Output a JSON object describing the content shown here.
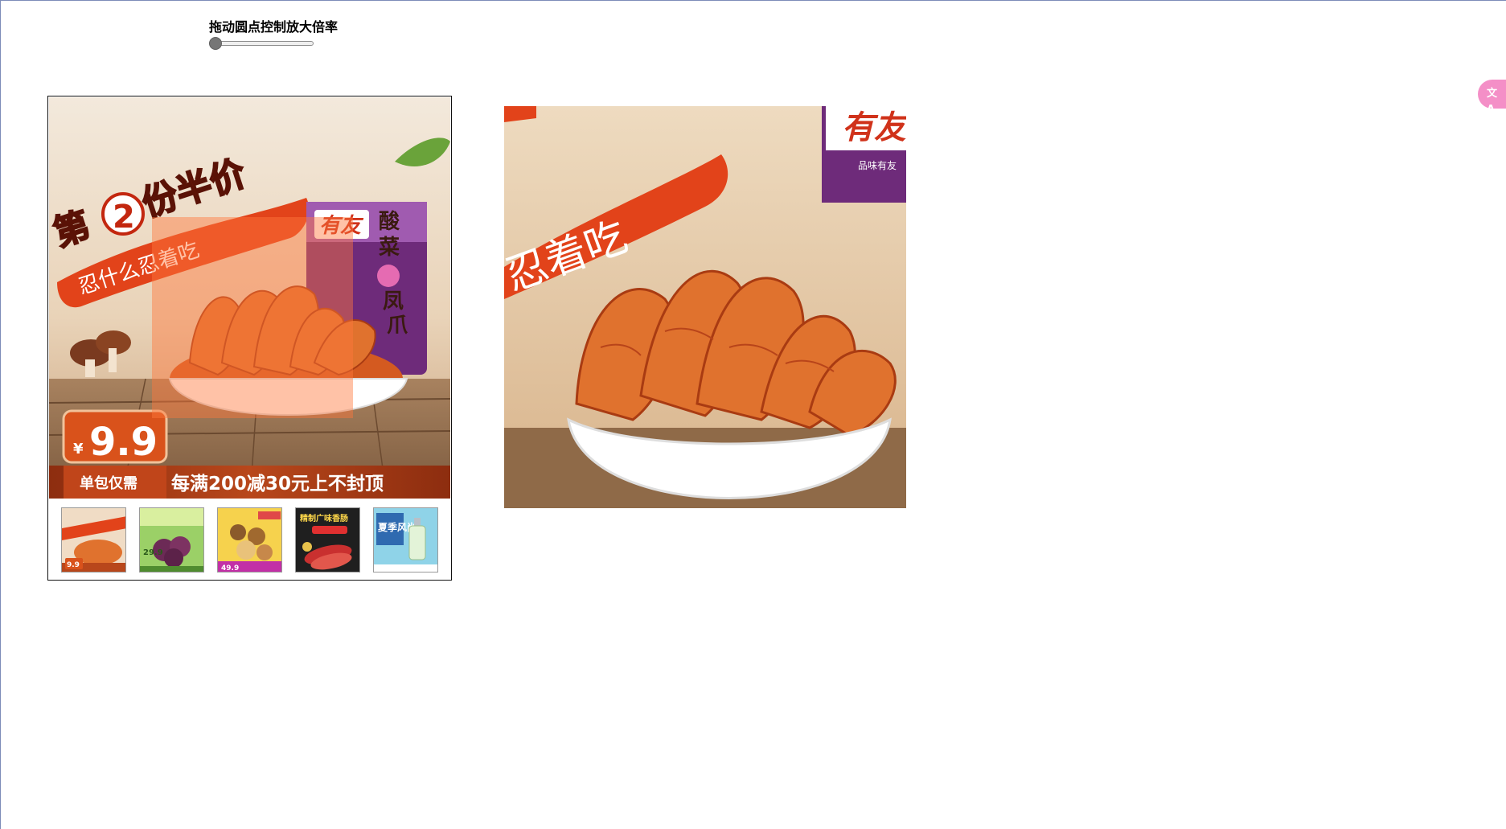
{
  "zoom_control": {
    "title": "拖动圆点控制放大倍率",
    "level": 0
  },
  "product": {
    "main": {
      "headline_prefix": "第",
      "headline_number": "2",
      "headline_suffix": "份半价",
      "slogan": "忍什么忍着吃",
      "brand": "有友",
      "bag_title_1": "酸",
      "bag_title_2": "菜",
      "bag_title_3": "凤",
      "bag_title_4": "爪",
      "price_currency": "¥",
      "price": "9.9",
      "price_note": "单包仅需",
      "promo": "每满200减30元上不封顶"
    },
    "thumbnails": [
      {
        "name": "chicken-feet",
        "caption": "9.9",
        "active": true
      },
      {
        "name": "dried-plums",
        "caption": "29.9"
      },
      {
        "name": "nuts",
        "caption": "49.9"
      },
      {
        "name": "sausage",
        "caption": "精制广味香肠"
      },
      {
        "name": "perfume",
        "caption": "夏季风尚"
      }
    ]
  },
  "zoom_view": {
    "slogan": "忍着吃",
    "brand": "有友",
    "bag_text": "品味有友"
  },
  "colors": {
    "accent_red": "#e2431a",
    "price_orange": "#d9521b",
    "overlay": "rgba(255,120,60,0.45)",
    "translate_button": "#f48fc7"
  },
  "icons": {
    "translate": "translate-icon"
  },
  "translate_button": {
    "glyph": "文A"
  }
}
